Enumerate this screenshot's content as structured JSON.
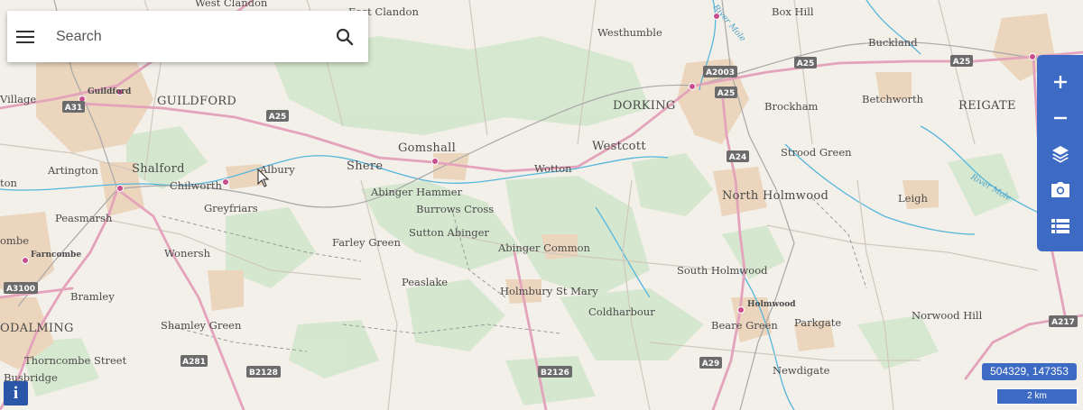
{
  "search": {
    "placeholder": "Search"
  },
  "map": {
    "labels": {
      "guildford_large": "GUILDFORD",
      "guildford_small": "Guildford",
      "dorking": "DORKING",
      "reigate": "REIGATE",
      "godalming": "ODALMING",
      "village": "Village",
      "west_clandon": "West Clandon",
      "east_clandon": "East Clandon",
      "westhumble": "Westhumble",
      "box_hill": "Box Hill",
      "buckland": "Buckland",
      "betchworth": "Betchworth",
      "brockham": "Brockham",
      "strood_green": "Strood Green",
      "north_holmwood": "North Holmwood",
      "leigh": "Leigh",
      "westcott": "Westcott",
      "wotton": "Wotton",
      "gomshall": "Gomshall",
      "shere": "Shere",
      "albury": "Albury",
      "shalford": "Shalford",
      "artington": "Artington",
      "chilworth": "Chilworth",
      "ton": "ton",
      "greyfriars": "Greyfriars",
      "abinger_hammer": "Abinger Hammer",
      "burrows_cross": "Burrows Cross",
      "sutton_abinger": "Sutton Abinger",
      "abinger_common": "Abinger Common",
      "farley_green": "Farley Green",
      "peasmarsh": "Peasmarsh",
      "combe": "ombe",
      "farncombe": "Farncombe",
      "wonersh": "Wonersh",
      "peaslake": "Peaslake",
      "holmbury_st_mary": "Holmbury St Mary",
      "south_holmwood": "South Holmwood",
      "holmwood": "Holmwood",
      "bramley": "Bramley",
      "coldharbour": "Coldharbour",
      "beare_green": "Beare Green",
      "parkgate": "Parkgate",
      "norwood_hill": "Norwood Hill",
      "shamley_green": "Shamley Green",
      "thorncombe_street": "Thorncombe Street",
      "busbridge": "Busbridge",
      "newdigate": "Newdigate",
      "river_mole_1": "River Mole",
      "river_mole_2": "River Mole"
    },
    "roads": {
      "a31": "A31",
      "a25_a": "A25",
      "a25_b": "A25",
      "a25_c": "A25",
      "a25_d": "A25",
      "a2003": "A2003",
      "a24": "A24",
      "a3100": "A3100",
      "a281": "A281",
      "b2128": "B2128",
      "b2126": "B2126",
      "a29": "A29",
      "a217": "A217"
    }
  },
  "tools": {
    "zoom_in": "plus-icon",
    "zoom_out": "minus-icon",
    "layers": "layers-icon",
    "screenshot": "camera-icon",
    "legend": "list-icon"
  },
  "coordinates": "504329, 147353",
  "scale": "2 km",
  "info": "i",
  "colors": {
    "accent": "#3d6bc4",
    "road_a": "#e0a0b8",
    "water": "#4fb3d9",
    "woodland": "#d3e6cc",
    "urban": "#ead4bd"
  }
}
